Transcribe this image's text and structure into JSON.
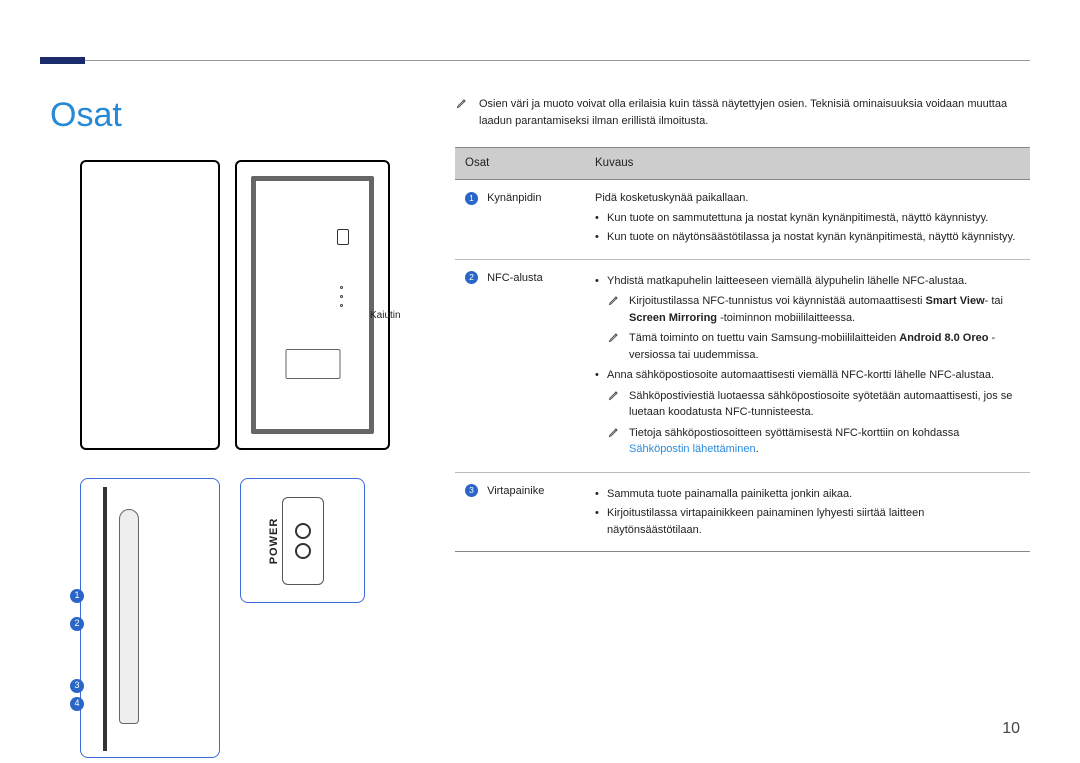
{
  "page": {
    "title": "Osat",
    "number": "10"
  },
  "labels": {
    "speaker": "Kaiutin",
    "power": "POWER"
  },
  "intro_note": "Osien väri ja muoto voivat olla erilaisia kuin tässä näytettyjen osien. Teknisiä ominaisuuksia voidaan muuttaa laadun parantamiseksi ilman erillistä ilmoitusta.",
  "table": {
    "headers": {
      "osat": "Osat",
      "kuvaus": "Kuvaus"
    },
    "rows": [
      {
        "num": "1",
        "name": "Kynänpidin",
        "lead": "Pidä kosketuskynää paikallaan.",
        "bullets": [
          "Kun tuote on sammutettuna ja nostat kynän kynänpitimestä, näyttö käynnistyy.",
          "Kun tuote on näytönsäästötilassa ja nostat kynän kynänpitimestä, näyttö käynnistyy."
        ]
      },
      {
        "num": "2",
        "name": "NFC-alusta",
        "block1": {
          "bullet": "Yhdistä matkapuhelin laitteeseen viemällä älypuhelin lähelle NFC-alustaa.",
          "note_a_pre": "Kirjoitustilassa NFC-tunnistus voi käynnistää automaattisesti ",
          "note_a_b1": "Smart View",
          "note_a_mid": "- tai ",
          "note_a_b2": "Screen Mirroring",
          "note_a_post": " -toiminnon mobiililaitteessa.",
          "note_b_pre": "Tämä toiminto on tuettu vain Samsung-mobiililaitteiden ",
          "note_b_b": "Android 8.0 Oreo",
          "note_b_post": " -versiossa tai uudemmissa."
        },
        "block2": {
          "bullet": "Anna sähköpostiosoite automaattisesti viemällä NFC-kortti lähelle NFC-alustaa.",
          "note_c": "Sähköpostiviestiä luotaessa sähköpostiosoite syötetään automaattisesti, jos se luetaan koodatusta NFC-tunnisteesta.",
          "note_d_pre": "Tietoja sähköpostiosoitteen syöttämisestä NFC-korttiin on kohdassa ",
          "note_d_link": "Sähköpostin lähettäminen",
          "note_d_post": "."
        }
      },
      {
        "num": "3",
        "name": "Virtapainike",
        "bullets": [
          "Sammuta tuote painamalla painiketta jonkin aikaa.",
          "Kirjoitustilassa virtapainikkeen painaminen lyhyesti siirtää laitteen näytönsäästötilaan."
        ]
      }
    ]
  },
  "pen_markers": [
    "1",
    "2",
    "3",
    "4"
  ]
}
